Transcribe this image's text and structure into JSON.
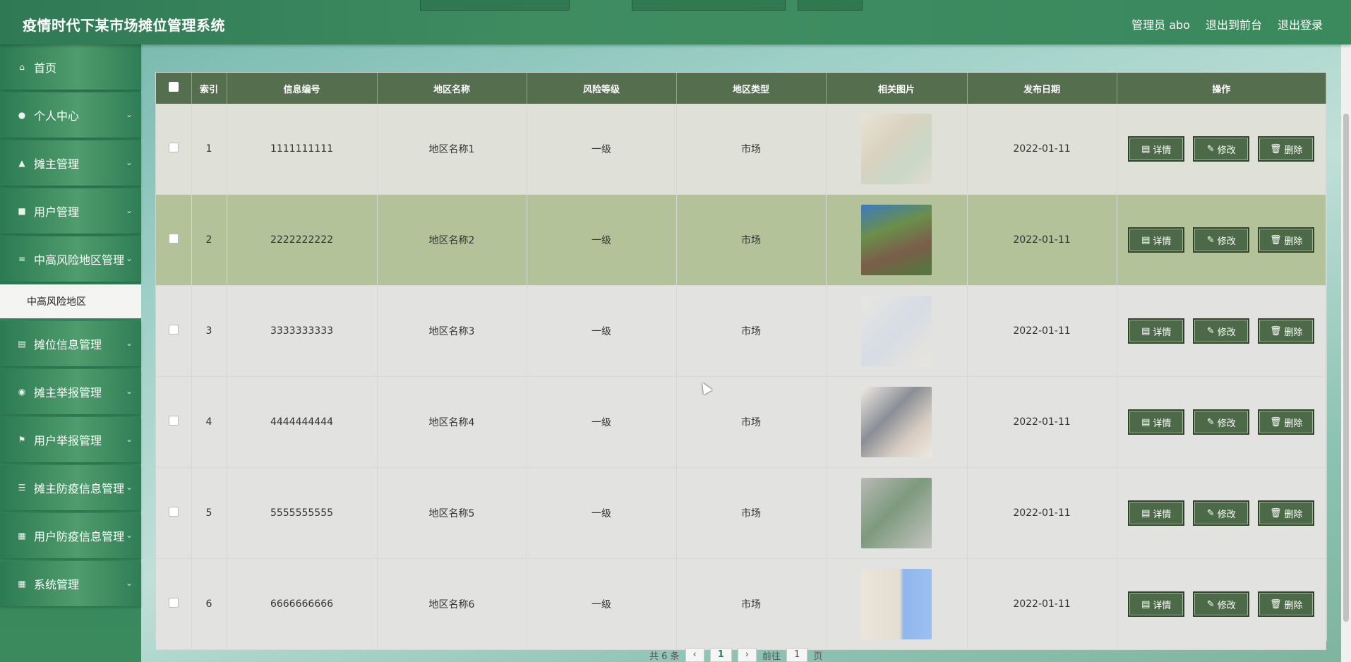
{
  "header": {
    "title": "疫情时代下某市场摊位管理系统",
    "admin": "管理员 abo",
    "to_front": "退出到前台",
    "logout": "退出登录"
  },
  "sidebar": {
    "items": [
      {
        "label": "首页",
        "icon": "home-icon",
        "chevron": false
      },
      {
        "label": "个人中心",
        "icon": "user-icon",
        "chevron": true
      },
      {
        "label": "摊主管理",
        "icon": "person-icon",
        "chevron": true
      },
      {
        "label": "用户管理",
        "icon": "briefcase-icon",
        "chevron": true
      },
      {
        "label": "中高风险地区管理",
        "icon": "list-icon",
        "chevron": true
      },
      {
        "label": "摊位信息管理",
        "icon": "clipboard-icon",
        "chevron": true
      },
      {
        "label": "摊主举报管理",
        "icon": "location-icon",
        "chevron": true
      },
      {
        "label": "用户举报管理",
        "icon": "flag-icon",
        "chevron": true
      },
      {
        "label": "摊主防疫信息管理",
        "icon": "sliders-icon",
        "chevron": true
      },
      {
        "label": "用户防疫信息管理",
        "icon": "grid-icon",
        "chevron": true
      },
      {
        "label": "系统管理",
        "icon": "grid-icon",
        "chevron": true
      }
    ],
    "submenu_label": "中高风险地区"
  },
  "table": {
    "headers": [
      "索引",
      "信息编号",
      "地区名称",
      "风险等级",
      "地区类型",
      "相关图片",
      "发布日期",
      "操作"
    ],
    "rows": [
      {
        "index": "1",
        "code": "1111111111",
        "name": "地区名称1",
        "level": "一级",
        "type": "市场",
        "date": "2022-01-11"
      },
      {
        "index": "2",
        "code": "2222222222",
        "name": "地区名称2",
        "level": "一级",
        "type": "市场",
        "date": "2022-01-11"
      },
      {
        "index": "3",
        "code": "3333333333",
        "name": "地区名称3",
        "level": "一级",
        "type": "市场",
        "date": "2022-01-11"
      },
      {
        "index": "4",
        "code": "4444444444",
        "name": "地区名称4",
        "level": "一级",
        "type": "市场",
        "date": "2022-01-11"
      },
      {
        "index": "5",
        "code": "5555555555",
        "name": "地区名称5",
        "level": "一级",
        "type": "市场",
        "date": "2022-01-11"
      },
      {
        "index": "6",
        "code": "6666666666",
        "name": "地区名称6",
        "level": "一级",
        "type": "市场",
        "date": "2022-01-11"
      }
    ],
    "actions": {
      "detail": "详情",
      "edit": "修改",
      "delete": "删除"
    }
  },
  "pager": {
    "total": "共 6 条",
    "current": "1",
    "goto": "前往",
    "goto_value": "1",
    "page": "页"
  },
  "colors": {
    "accent": "#2f7a55",
    "header_row": "#556e4e",
    "button": "#4d6a48",
    "highlight_row": "#b3c298"
  }
}
